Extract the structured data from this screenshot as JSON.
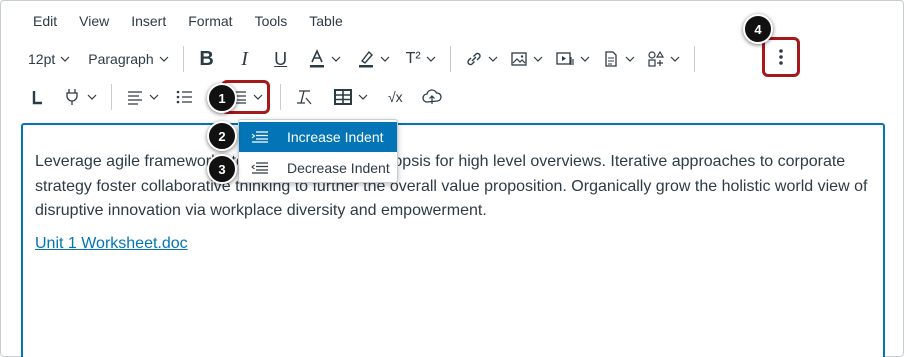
{
  "menubar": [
    "Edit",
    "View",
    "Insert",
    "Format",
    "Tools",
    "Table"
  ],
  "toolbar": {
    "font_size": "12pt",
    "block_format": "Paragraph",
    "superscript_label": "T²",
    "formula_label": "√x"
  },
  "icons": [
    "bold-icon",
    "italic-icon",
    "underline-icon",
    "text-color-icon",
    "highlight-icon",
    "superscript-icon",
    "link-icon",
    "image-icon",
    "media-icon",
    "document-icon",
    "apps-icon",
    "more-vertical-icon",
    "ltr-direction-icon",
    "plugin-icon",
    "align-icon",
    "bullet-list-icon",
    "indent-icon",
    "clear-format-icon",
    "table-icon",
    "equation-icon",
    "cloud-icon"
  ],
  "indent_menu": {
    "items": [
      {
        "label": "Increase Indent",
        "icon": "increase-indent-icon",
        "selected": true
      },
      {
        "label": "Decrease Indent",
        "icon": "decrease-indent-icon",
        "selected": false
      }
    ]
  },
  "callouts": [
    "1",
    "2",
    "3",
    "4"
  ],
  "editor": {
    "paragraph": "Leverage agile frameworks to provide a robust synopsis for high level overviews. Iterative approaches to corporate strategy foster collaborative thinking to further the overall value proposition. Organically grow the holistic world view of disruptive innovation via workplace diversity and empowerment.",
    "link_text": "Unit 1 Worksheet.doc"
  },
  "colors": {
    "accent": "#0374b5",
    "callout_highlight": "#a5181b",
    "text": "#2d3b45"
  }
}
